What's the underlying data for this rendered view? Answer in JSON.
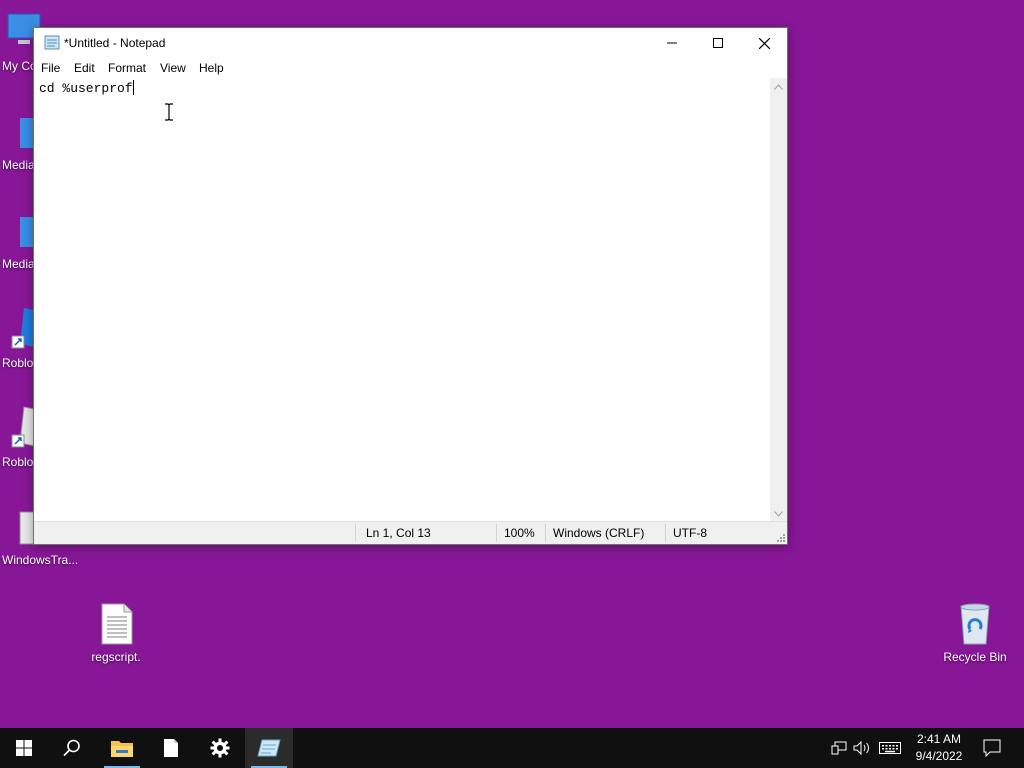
{
  "desktop": {
    "icons": [
      {
        "label": "My Co"
      },
      {
        "label": "Media"
      },
      {
        "label": "Media"
      },
      {
        "label": "Roblo"
      },
      {
        "label": "Roblo"
      },
      {
        "label": "WindowsTra..."
      },
      {
        "label": "regscript."
      },
      {
        "label": "Recycle Bin"
      }
    ]
  },
  "notepad": {
    "title": "*Untitled - Notepad",
    "menu": [
      "File",
      "Edit",
      "Format",
      "View",
      "Help"
    ],
    "content": "cd %userprof",
    "status": {
      "position": "Ln 1, Col 13",
      "zoom": "100%",
      "line_ending": "Windows (CRLF)",
      "encoding": "UTF-8"
    }
  },
  "taskbar": {
    "clock_time": "2:41 AM",
    "clock_date": "9/4/2022",
    "items": [
      "start-icon",
      "search-icon",
      "file-explorer-icon",
      "blank-file-icon",
      "settings-gear-icon",
      "notepad-icon"
    ]
  },
  "colors": {
    "desktop_bg": "#881798",
    "taskbar_bg": "#101010",
    "accent": "#76b9ed"
  }
}
